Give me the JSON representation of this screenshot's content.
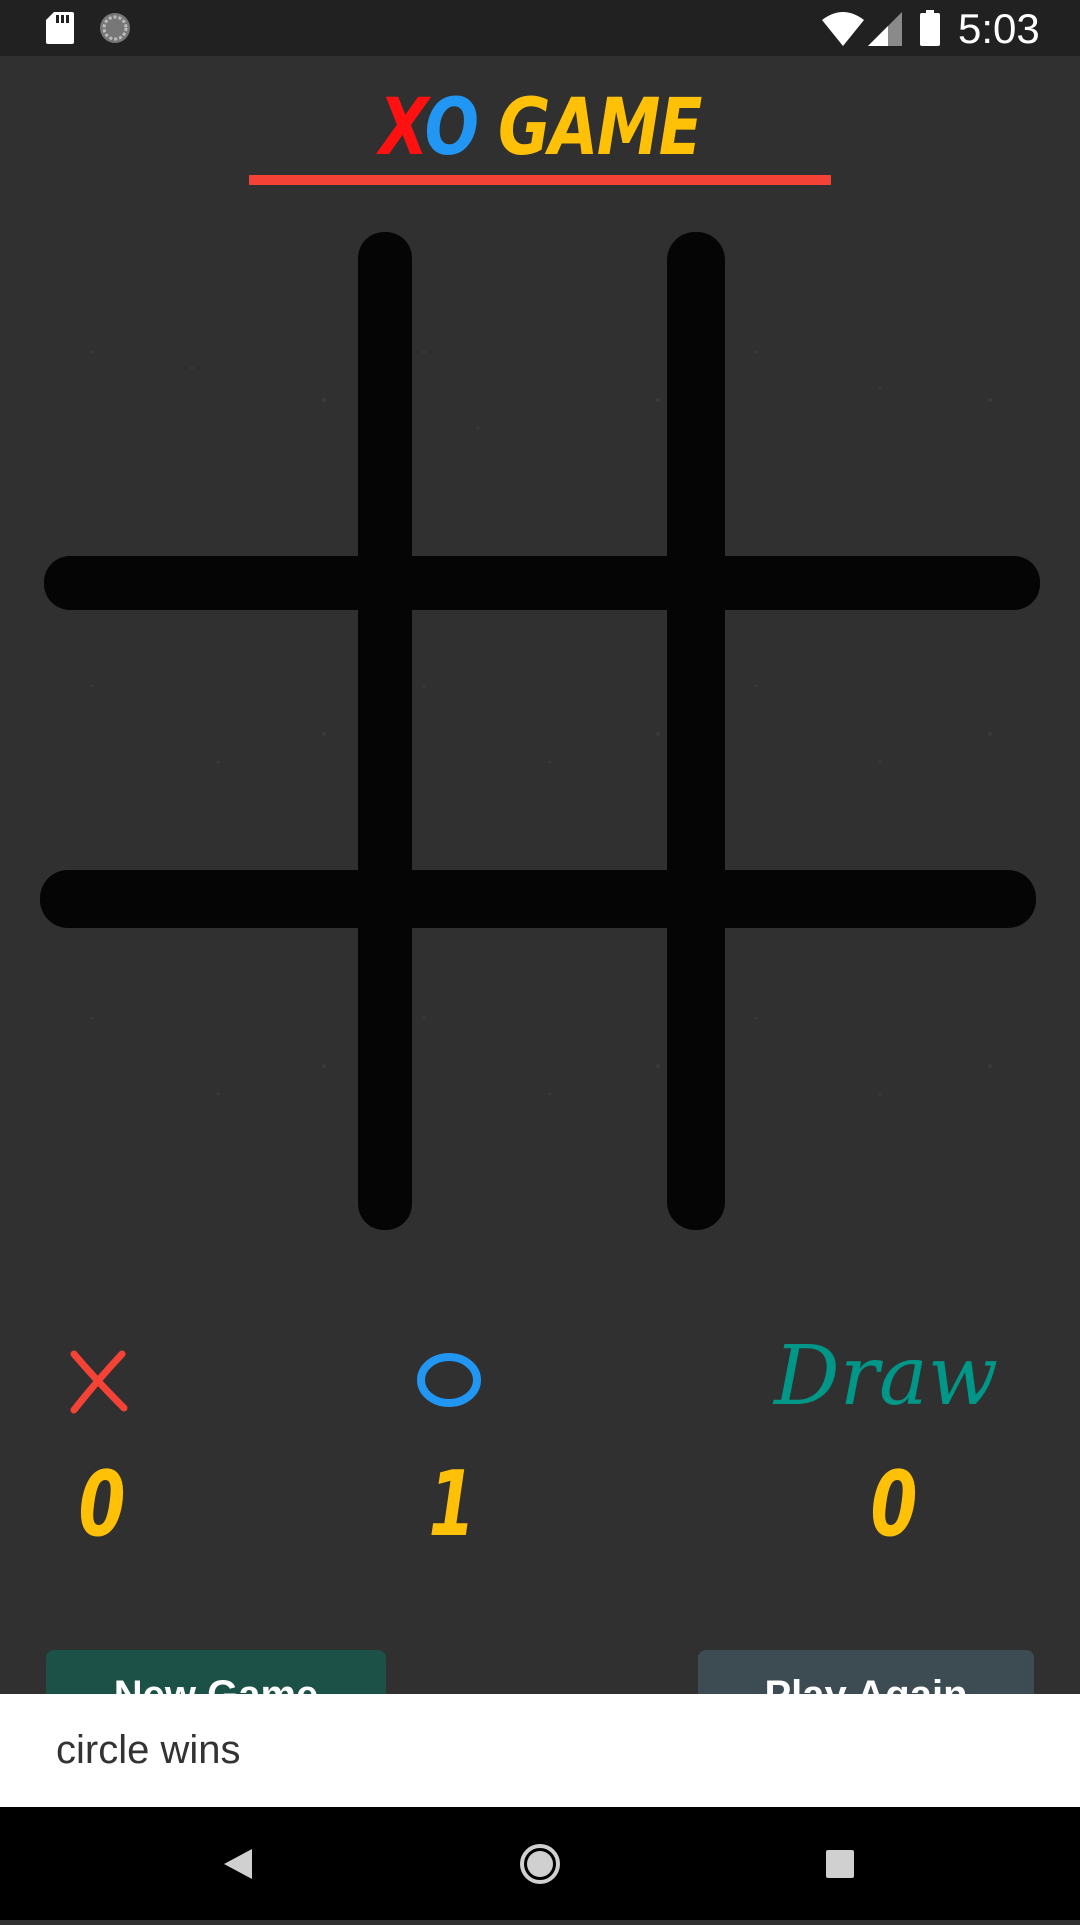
{
  "status_bar": {
    "time": "5:03",
    "icons": [
      "sd-card-icon",
      "sync-icon",
      "wifi-icon",
      "cell-signal-icon",
      "battery-icon"
    ]
  },
  "header": {
    "title_x": "X",
    "title_o": "O",
    "title_rest": " GAME",
    "colors": {
      "x": "#ff1111",
      "o": "#2196f3",
      "game": "#ffc107",
      "underline": "#f44336"
    }
  },
  "board": {
    "cells": [
      "",
      "",
      "",
      "",
      "",
      "",
      "",
      "",
      ""
    ]
  },
  "scoreboard": {
    "x": {
      "label": "X",
      "score": "0",
      "color": "#f44336"
    },
    "o": {
      "label": "O",
      "score": "1",
      "color": "#2196f3"
    },
    "draw": {
      "label": "Draw",
      "score": "0",
      "color": "#009688"
    },
    "score_color": "#ffc107"
  },
  "buttons": {
    "new_game": "New Game",
    "play_again": "Play Again"
  },
  "snackbar": {
    "message": "circle wins"
  },
  "nav_bar": {
    "icons": [
      "back-icon",
      "home-icon",
      "recents-icon"
    ]
  }
}
